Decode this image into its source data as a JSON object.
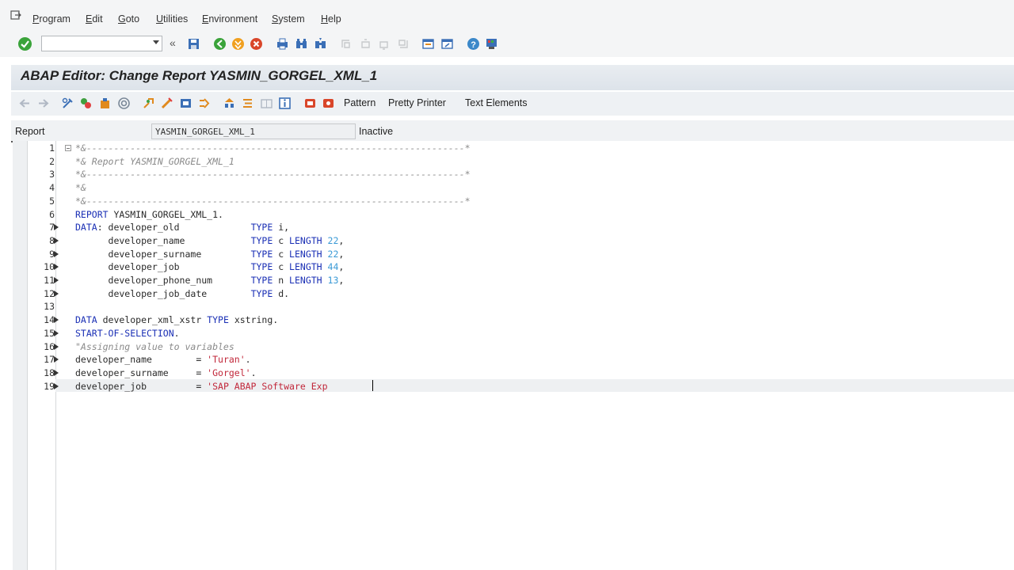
{
  "menu": {
    "items": [
      {
        "label": "Program",
        "u": "P",
        "rest": "rogram"
      },
      {
        "label": "Edit",
        "u": "E",
        "rest": "dit"
      },
      {
        "label": "Goto",
        "u": "G",
        "rest": "oto"
      },
      {
        "label": "Utilities",
        "u": "U",
        "rest": "tilities"
      },
      {
        "label": "Environment",
        "u": "E",
        "rest": "nvironment"
      },
      {
        "label": "System",
        "u": "S",
        "rest": "ystem"
      },
      {
        "label": "Help",
        "u": "H",
        "rest": "elp"
      }
    ]
  },
  "toolbar": {
    "command_value": "",
    "collapse_glyph": "«"
  },
  "title": "ABAP Editor: Change Report YASMIN_GORGEL_XML_1",
  "app_toolbar": {
    "pattern": "Pattern",
    "pretty_printer": "Pretty Printer",
    "text_elements": "Text Elements"
  },
  "report": {
    "label": "Report",
    "name": "YASMIN_GORGEL_XML_1",
    "status": "Inactive"
  },
  "editor": {
    "lines": [
      {
        "n": "1",
        "segs": [
          [
            "cm",
            "*&---------------------------------------------------------------------*"
          ]
        ]
      },
      {
        "n": "2",
        "segs": [
          [
            "cm",
            "*& Report YASMIN_GORGEL_XML_1"
          ]
        ]
      },
      {
        "n": "3",
        "segs": [
          [
            "cm",
            "*&---------------------------------------------------------------------*"
          ]
        ]
      },
      {
        "n": "4",
        "segs": [
          [
            "cm",
            "*&"
          ]
        ]
      },
      {
        "n": "5",
        "segs": [
          [
            "cm",
            "*&---------------------------------------------------------------------*"
          ]
        ]
      },
      {
        "n": "6",
        "segs": [
          [
            "kw",
            "REPORT"
          ],
          [
            "",
            " YASMIN_GORGEL_XML_1."
          ]
        ]
      },
      {
        "n": "7",
        "segs": [
          [
            "kw",
            "DATA"
          ],
          [
            "",
            ": developer_old             "
          ],
          [
            "kw",
            "TYPE"
          ],
          [
            "",
            " i,"
          ]
        ]
      },
      {
        "n": "8",
        "segs": [
          [
            "",
            "      developer_name            "
          ],
          [
            "kw",
            "TYPE"
          ],
          [
            "",
            " c "
          ],
          [
            "kw",
            "LENGTH"
          ],
          [
            "",
            " "
          ],
          [
            "nm",
            "22"
          ],
          [
            "",
            ","
          ]
        ]
      },
      {
        "n": "9",
        "segs": [
          [
            "",
            "      developer_surname         "
          ],
          [
            "kw",
            "TYPE"
          ],
          [
            "",
            " c "
          ],
          [
            "kw",
            "LENGTH"
          ],
          [
            "",
            " "
          ],
          [
            "nm",
            "22"
          ],
          [
            "",
            ","
          ]
        ]
      },
      {
        "n": "10",
        "segs": [
          [
            "",
            "      developer_job             "
          ],
          [
            "kw",
            "TYPE"
          ],
          [
            "",
            " c "
          ],
          [
            "kw",
            "LENGTH"
          ],
          [
            "",
            " "
          ],
          [
            "nm",
            "44"
          ],
          [
            "",
            ","
          ]
        ]
      },
      {
        "n": "11",
        "segs": [
          [
            "",
            "      developer_phone_num       "
          ],
          [
            "kw",
            "TYPE"
          ],
          [
            "",
            " n "
          ],
          [
            "kw",
            "LENGTH"
          ],
          [
            "",
            " "
          ],
          [
            "nm",
            "13"
          ],
          [
            "",
            ","
          ]
        ]
      },
      {
        "n": "12",
        "segs": [
          [
            "",
            "      developer_job_date        "
          ],
          [
            "kw",
            "TYPE"
          ],
          [
            "",
            " d."
          ]
        ]
      },
      {
        "n": "13",
        "segs": []
      },
      {
        "n": "14",
        "segs": [
          [
            "kw",
            "DATA"
          ],
          [
            "",
            " developer_xml_xstr "
          ],
          [
            "kw",
            "TYPE"
          ],
          [
            "",
            " xstring."
          ]
        ]
      },
      {
        "n": "15",
        "segs": [
          [
            "kw",
            "START-OF-SELECTION"
          ],
          [
            "",
            "."
          ]
        ]
      },
      {
        "n": "16",
        "segs": [
          [
            "cm",
            "\"Assigning value to variables"
          ]
        ]
      },
      {
        "n": "17",
        "segs": [
          [
            "",
            "developer_name        = "
          ],
          [
            "st",
            "'Turan'"
          ],
          [
            "",
            "."
          ]
        ]
      },
      {
        "n": "18",
        "segs": [
          [
            "",
            "developer_surname     = "
          ],
          [
            "st",
            "'Gorgel'"
          ],
          [
            "",
            "."
          ]
        ]
      },
      {
        "n": "19",
        "segs": [
          [
            "",
            "developer_job         = "
          ],
          [
            "st",
            "'SAP ABAP Software Exp"
          ]
        ]
      }
    ]
  },
  "colors": {
    "keyword": "#1a2fb5",
    "comment": "#8a8a8a",
    "string": "#c1273a",
    "number": "#3a9ad6"
  }
}
